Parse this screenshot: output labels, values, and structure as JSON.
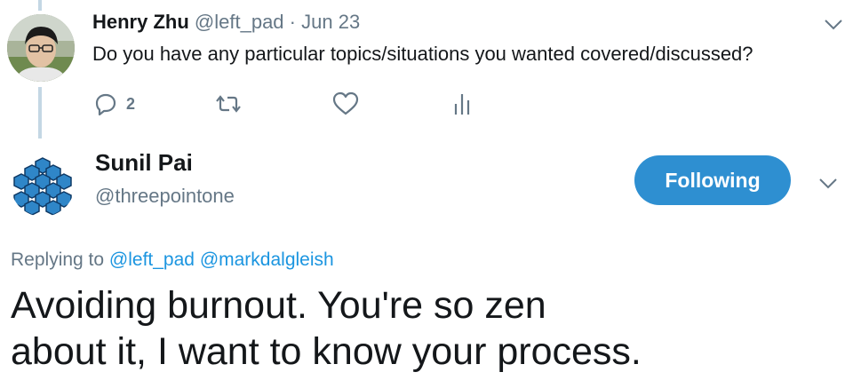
{
  "reply_tweet": {
    "author_name": "Henry Zhu",
    "author_handle": "@left_pad",
    "separator": "·",
    "date": "Jun 23",
    "text": "Do you have any particular topics/situations you wanted covered/discussed?",
    "reply_count": "2",
    "avatar_icon": "person-photo-avatar",
    "actions": [
      "reply-icon",
      "retweet-icon",
      "like-icon",
      "analytics-icon"
    ]
  },
  "main_tweet": {
    "author_name": "Sunil Pai",
    "author_handle": "@threepointone",
    "follow_label": "Following",
    "avatar_icon": "blue-cubes-avatar",
    "replying_prefix": "Replying to",
    "mentions": [
      "@left_pad",
      "@markdalgleish"
    ],
    "text_lines": [
      "Avoiding burnout. You're so zen",
      "about it, I want to know your process."
    ]
  },
  "colors": {
    "accent": "#1b95e0",
    "follow_button_bg": "#2e8fd1",
    "secondary_text": "#657786",
    "primary_text": "#14171a",
    "thread_line": "#c4d7e4"
  }
}
